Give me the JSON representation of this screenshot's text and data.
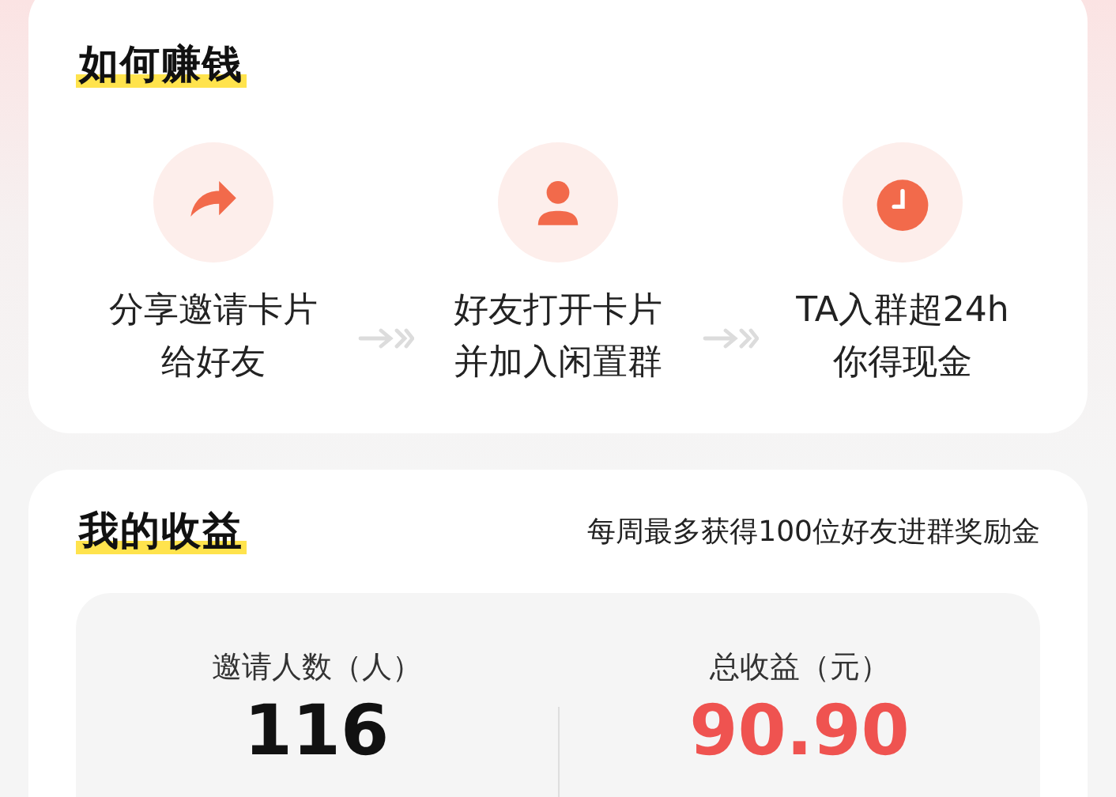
{
  "how_to_earn": {
    "title": "如何赚钱",
    "steps": [
      {
        "lines": [
          "分享邀请卡片",
          "给好友"
        ]
      },
      {
        "lines": [
          "好友打开卡片",
          "并加入闲置群"
        ]
      },
      {
        "lines": [
          "TA入群超24h",
          "你得现金"
        ]
      }
    ]
  },
  "my_earnings": {
    "title": "我的收益",
    "note": "每周最多获得100位好友进群奖励金",
    "stats": [
      {
        "label": "邀请人数（人）",
        "value": "116",
        "emphasis": false
      },
      {
        "label": "总收益（元）",
        "value": "90.90",
        "emphasis": true
      }
    ]
  }
}
